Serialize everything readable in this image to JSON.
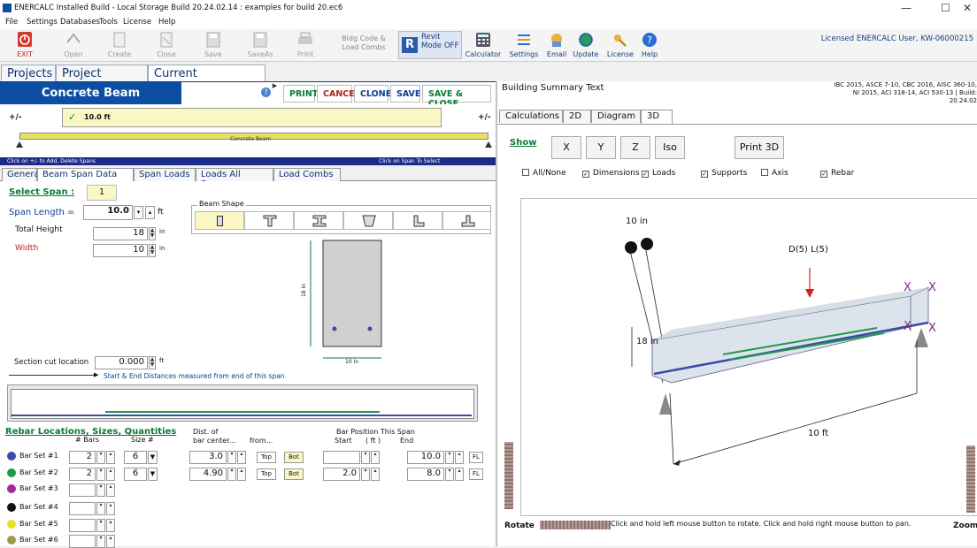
{
  "titlebar": {
    "title": "ENERCALC Installed Build - Local Storage Build 20.24.02.14 : examples for build 20.ec6",
    "min": "—",
    "max": "☐",
    "close": "✕"
  },
  "menu": [
    "File",
    "Settings",
    "Databases",
    "Tools",
    "License",
    "Help"
  ],
  "toolbar": {
    "buttons": [
      {
        "label": "EXIT"
      },
      {
        "label": "Open"
      },
      {
        "label": "Create"
      },
      {
        "label": "Close"
      },
      {
        "label": "Save"
      },
      {
        "label": "SaveAs"
      },
      {
        "label": "Print"
      }
    ],
    "bldg_code": "Bldg Code & Load Combs",
    "revit": "Revit Mode OFF",
    "right_buttons": [
      {
        "label": "Calculator"
      },
      {
        "label": "Settings"
      },
      {
        "label": "Email"
      },
      {
        "label": "Update"
      },
      {
        "label": "License"
      },
      {
        "label": "Help"
      }
    ],
    "licensed": "Licensed ENERCALC User, KW-06000215"
  },
  "main_tabs": [
    "Projects",
    "Project Manager",
    "Current Calculation"
  ],
  "module_title": "Concrete Beam",
  "help_glyph": "?",
  "action_buttons": [
    "PRINT",
    "CANCEL",
    "CLONE",
    "SAVE",
    "SAVE & CLOSE"
  ],
  "span_editor": {
    "plus_minus": "+/-",
    "span_value": "10.0 ft",
    "beam_label": "Concrete Beam",
    "hint_left": "Click on +/- to Add, Delete Spans",
    "hint_right": "Click on Span To Select"
  },
  "sub_tabs": [
    "General",
    "Beam Span Data",
    "Span Loads",
    "Loads All Spans",
    "Load Combs"
  ],
  "beam_data": {
    "select_span_label": "Select Span :",
    "select_span_value": "1",
    "span_length_label": "Span Length =",
    "span_length_value": "10.0",
    "span_length_unit": "ft",
    "total_height_label": "Total Height",
    "total_height_value": "18",
    "total_height_unit": "in",
    "width_label": "Width",
    "width_value": "10",
    "width_unit": "in",
    "beam_shape_label": "Beam Shape",
    "section_height_label": "18 in",
    "section_width_label": "10 in",
    "section_cut_label": "Section cut location",
    "section_cut_value": "0.000",
    "section_cut_unit": "ft",
    "distance_note": "Start & End Distances measured from end of this span"
  },
  "rebar": {
    "title": "Rebar Locations, Sizes, Quantities",
    "headers": {
      "bars": "# Bars",
      "size": "Size #",
      "dist1": "Dist. of",
      "dist2": "bar center...",
      "from": "from...",
      "barpos": "Bar Position This Span",
      "start": "Start",
      "unit": "( ft )",
      "end": "End"
    },
    "sets": [
      {
        "label": "Bar Set #1",
        "color": "#3a4aa8",
        "bars": "2",
        "size": "6",
        "dist": "3.0",
        "top": "Top",
        "bot": "Bot",
        "start": "",
        "end": "10.0",
        "fl": "FL"
      },
      {
        "label": "Bar Set #2",
        "color": "#1f9a4a",
        "bars": "2",
        "size": "6",
        "dist": "4.90",
        "top": "Top",
        "bot": "Bot",
        "start": "2.0",
        "end": "8.0",
        "fl": "FL"
      },
      {
        "label": "Bar Set #3",
        "color": "#a02a9a",
        "bars": ""
      },
      {
        "label": "Bar Set #4",
        "color": "#111111",
        "bars": ""
      },
      {
        "label": "Bar Set #5",
        "color": "#e8e02a",
        "bars": ""
      },
      {
        "label": "Bar Set #6",
        "color": "#9a9a50",
        "bars": ""
      }
    ]
  },
  "right": {
    "summary_title": "Building Summary Text",
    "codes": "IBC 2015, ASCE 7-10, CBC 2016, AISC 360-10, NI 2015, ACI 318-14, ACI 530-13 | Build: 20.24.02",
    "tabs": [
      "Calculations",
      "2D",
      "Diagram",
      "3D"
    ],
    "show": "Show",
    "view_buttons": [
      "X",
      "Y",
      "Z",
      "Iso"
    ],
    "print3d": "Print 3D",
    "checks": [
      {
        "label": "All/None",
        "on": false
      },
      {
        "label": "Dimensions",
        "on": true
      },
      {
        "label": "Loads",
        "on": true
      },
      {
        "label": "Supports",
        "on": true
      },
      {
        "label": "Axis",
        "on": false
      },
      {
        "label": "Rebar",
        "on": true
      }
    ],
    "dim_width": "10 in",
    "dim_height": "18 in",
    "dim_length": "10 ft",
    "load_label": "D(5) L(5)",
    "rotate": "Rotate",
    "zoom": "Zoom",
    "hint": "Click and hold left mouse button to rotate. Click and hold right mouse button to pan."
  }
}
